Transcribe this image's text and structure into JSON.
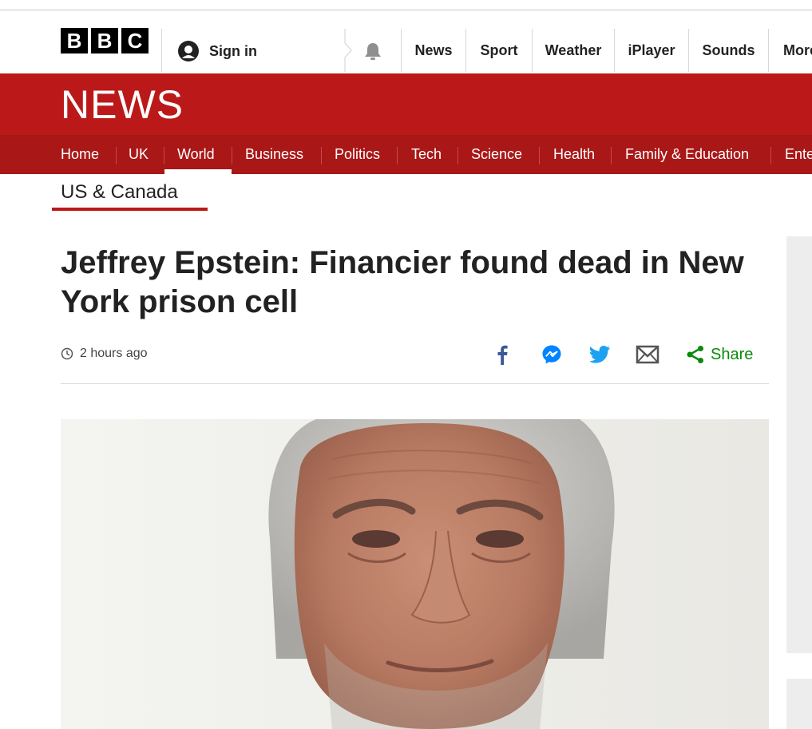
{
  "brand": {
    "logo_letters": [
      "B",
      "B",
      "C"
    ],
    "news_label": "NEWS"
  },
  "account": {
    "sign_in_label": "Sign in"
  },
  "top_nav": [
    "News",
    "Sport",
    "Weather",
    "iPlayer",
    "Sounds",
    "More"
  ],
  "section_nav": {
    "items": [
      "Home",
      "UK",
      "World",
      "Business",
      "Politics",
      "Tech",
      "Science",
      "Health",
      "Family & Education",
      "Entertainment"
    ],
    "active": "World"
  },
  "sub_nav": {
    "label": "US & Canada"
  },
  "article": {
    "headline": "Jeffrey Epstein: Financier found dead in New York prison cell",
    "timestamp": "2 hours ago",
    "share_label": "Share"
  },
  "icons": {
    "share": [
      "facebook-icon",
      "messenger-icon",
      "twitter-icon",
      "email-icon",
      "share-icon"
    ],
    "misc": [
      "user-icon",
      "bell-icon",
      "clock-icon"
    ]
  },
  "colors": {
    "brand_red": "#bb1919",
    "nav_red": "#a91717",
    "facebook": "#3b5998",
    "messenger": "#0084ff",
    "twitter": "#1da1f2",
    "share_green": "#0b8a0b"
  }
}
